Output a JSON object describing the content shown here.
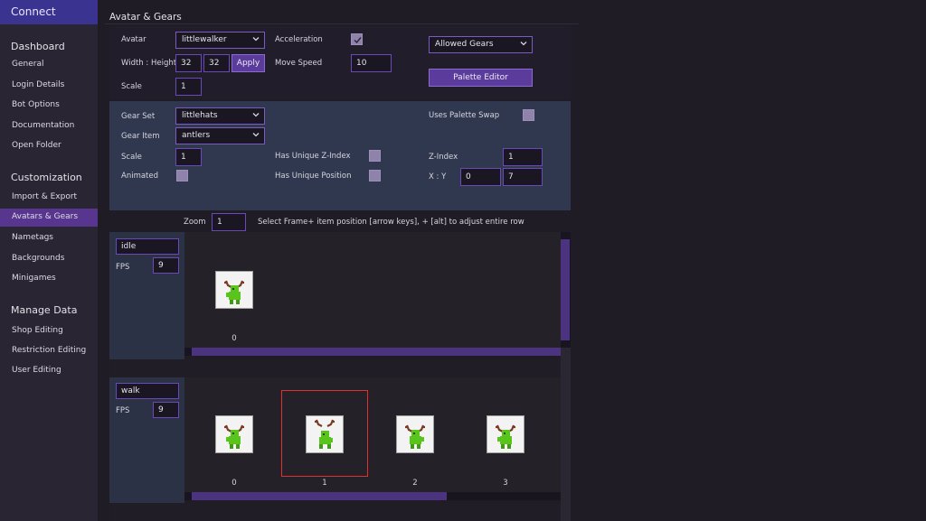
{
  "sidebar": {
    "connect": "Connect",
    "sections": [
      {
        "heading": "Dashboard",
        "items": [
          "General",
          "Login Details",
          "Bot Options",
          "Documentation",
          "Open Folder"
        ]
      },
      {
        "heading": "Customization",
        "items": [
          "Import & Export",
          "Avatars & Gears",
          "Nametags",
          "Backgrounds",
          "Minigames"
        ]
      },
      {
        "heading": "Manage Data",
        "items": [
          "Shop Editing",
          "Restriction Editing",
          "User Editing"
        ]
      }
    ],
    "active_item": "Avatars & Gears"
  },
  "main": {
    "title": "Avatar & Gears",
    "avatar_panel": {
      "avatar_label": "Avatar",
      "avatar_value": "littlewalker",
      "width_height_label": "Width : Height",
      "width_value": "32",
      "height_value": "32",
      "apply_label": "Apply",
      "scale_label": "Scale",
      "scale_value": "1",
      "acceleration_label": "Acceleration",
      "acceleration_checked": true,
      "move_speed_label": "Move Speed",
      "move_speed_value": "10",
      "allowed_gears_label": "Allowed Gears",
      "palette_editor_label": "Palette Editor"
    },
    "gear_panel": {
      "gear_set_label": "Gear Set",
      "gear_set_value": "littlehats",
      "gear_item_label": "Gear Item",
      "gear_item_value": "antlers",
      "scale_label": "Scale",
      "scale_value": "1",
      "animated_label": "Animated",
      "animated_checked": false,
      "unique_z_label": "Has Unique Z-Index",
      "unique_z_checked": false,
      "unique_pos_label": "Has Unique Position",
      "unique_pos_checked": false,
      "palette_swap_label": "Uses Palette Swap",
      "palette_swap_checked": false,
      "z_index_label": "Z-Index",
      "z_index_value": "1",
      "xy_label": "X : Y",
      "x_value": "0",
      "y_value": "7"
    },
    "zoom_bar": {
      "zoom_label": "Zoom",
      "zoom_value": "1",
      "hint": "Select Frame+ item position [arrow keys], + [alt] to adjust entire row"
    },
    "animations": [
      {
        "name": "idle",
        "fps_label": "FPS",
        "fps": "9",
        "frames": [
          "0"
        ],
        "selected_frame": null
      },
      {
        "name": "walk",
        "fps_label": "FPS",
        "fps": "9",
        "frames": [
          "0",
          "1",
          "2",
          "3"
        ],
        "selected_frame": "1"
      }
    ]
  },
  "colors": {
    "accent": "#58368f",
    "field_border": "#6a49b8",
    "selection": "#e03030",
    "sprite_green": "#58c41c",
    "antler_brown": "#7a3a22"
  },
  "icons": {
    "dropdown": "chevron-down-icon",
    "check": "checkmark-icon",
    "sprite": "sprite-icon"
  }
}
